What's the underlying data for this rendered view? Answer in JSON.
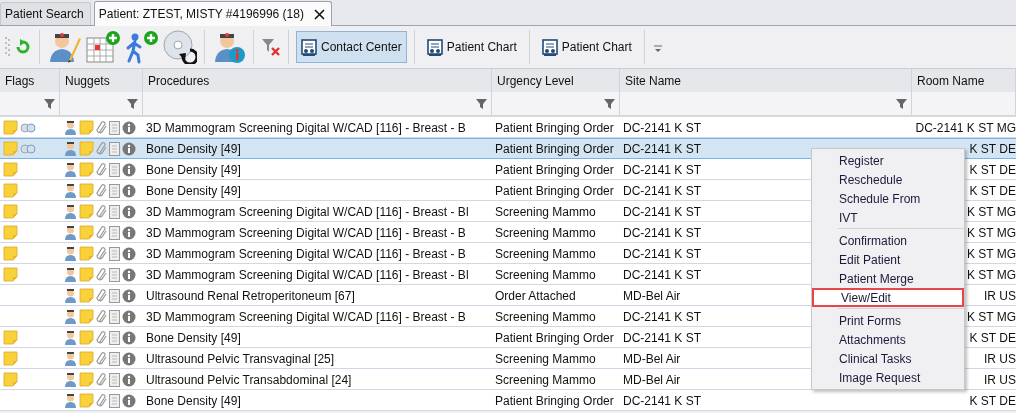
{
  "tabs": [
    {
      "label": "Patient Search",
      "selected": false,
      "closable": false
    },
    {
      "label": "Patient: ZTEST, MISTY #4196996 (18)",
      "selected": true,
      "closable": true
    }
  ],
  "toolbar": [
    {
      "kind": "grip"
    },
    {
      "kind": "refresh"
    },
    {
      "kind": "separator"
    },
    {
      "kind": "person-pencil"
    },
    {
      "kind": "calendar-plus"
    },
    {
      "kind": "walker-plus"
    },
    {
      "kind": "disc"
    },
    {
      "kind": "separator"
    },
    {
      "kind": "person-info"
    },
    {
      "kind": "separator"
    },
    {
      "kind": "filter-clear"
    },
    {
      "kind": "separator"
    },
    {
      "kind": "text",
      "label": "Contact Center",
      "pressed": true
    },
    {
      "kind": "separator"
    },
    {
      "kind": "text",
      "label": "Patient Chart",
      "pressed": false
    },
    {
      "kind": "separator"
    },
    {
      "kind": "text",
      "label": "Patient Chart",
      "pressed": false
    },
    {
      "kind": "separator"
    },
    {
      "kind": "overflow"
    }
  ],
  "table": {
    "columns": [
      {
        "label": "Flags",
        "filter": true
      },
      {
        "label": "Nuggets",
        "filter": true
      },
      {
        "label": "Procedures",
        "filter": true
      },
      {
        "label": "Urgency Level",
        "filter": true
      },
      {
        "label": "Site Name",
        "filter": true
      },
      {
        "label": "Room Name",
        "filter": false
      }
    ],
    "rows": [
      {
        "note": true,
        "linked": true,
        "procedure": "3D Mammogram Screening Digital W/CAD [116] - Breast - B",
        "urgency": "Patient Bringing Order",
        "site": "DC-2141 K ST",
        "room": "DC-2141 K ST MG",
        "selected": false
      },
      {
        "note": true,
        "linked": true,
        "procedure": "Bone Density [49]",
        "urgency": "Patient Bringing Order",
        "site": "DC-2141 K ST",
        "room": "K ST DE",
        "selected": true
      },
      {
        "note": true,
        "linked": false,
        "procedure": "Bone Density [49]",
        "urgency": "Patient Bringing Order",
        "site": "DC-2141 K ST",
        "room": "K ST DE",
        "selected": false
      },
      {
        "note": true,
        "linked": false,
        "procedure": "Bone Density [49]",
        "urgency": "Patient Bringing Order",
        "site": "DC-2141 K ST",
        "room": "K ST DE",
        "selected": false
      },
      {
        "note": true,
        "linked": false,
        "procedure": "3D Mammogram Screening Digital W/CAD [116] - Breast - Bl",
        "urgency": "Screening Mammo",
        "site": "DC-2141 K ST",
        "room": "K ST MG",
        "selected": false
      },
      {
        "note": true,
        "linked": false,
        "procedure": "3D Mammogram Screening Digital W/CAD [116] - Breast - B",
        "urgency": "Screening Mammo",
        "site": "DC-2141 K ST",
        "room": "K ST MG",
        "selected": false
      },
      {
        "note": true,
        "linked": false,
        "procedure": "3D Mammogram Screening Digital W/CAD [116] - Breast - B",
        "urgency": "Screening Mammo",
        "site": "DC-2141 K ST",
        "room": "K ST MG",
        "selected": false
      },
      {
        "note": true,
        "linked": false,
        "procedure": "3D Mammogram Screening Digital W/CAD [116] - Breast - Bl",
        "urgency": "Screening Mammo",
        "site": "DC-2141 K ST",
        "room": "K ST MG",
        "selected": false
      },
      {
        "note": false,
        "linked": false,
        "procedure": "Ultrasound Renal Retroperitoneum [67]",
        "urgency": "Order Attached",
        "site": "MD-Bel Air",
        "room": "IR US",
        "selected": false
      },
      {
        "note": false,
        "linked": false,
        "procedure": "3D Mammogram Screening Digital W/CAD [116] - Breast - B",
        "urgency": "Screening Mammo",
        "site": "DC-2141 K ST",
        "room": "K ST MG",
        "selected": false
      },
      {
        "note": true,
        "linked": false,
        "procedure": "Bone Density [49]",
        "urgency": "Patient Bringing Order",
        "site": "DC-2141 K ST",
        "room": "K ST DE",
        "selected": false
      },
      {
        "note": true,
        "linked": false,
        "procedure": "Ultrasound Pelvic Transvaginal [25]",
        "urgency": "Screening Mammo",
        "site": "MD-Bel Air",
        "room": "IR US",
        "selected": false
      },
      {
        "note": true,
        "linked": false,
        "procedure": "Ultrasound Pelvic Transabdominal [24]",
        "urgency": "Screening Mammo",
        "site": "MD-Bel Air",
        "room": "IR US",
        "selected": false
      },
      {
        "note": false,
        "linked": false,
        "procedure": "Bone Density [49]",
        "urgency": "Patient Bringing Order",
        "site": "DC-2141 K ST",
        "room": "K ST DE",
        "selected": false
      }
    ]
  },
  "context_menu": {
    "items": [
      {
        "kind": "item",
        "label": "Register",
        "highlighted": false
      },
      {
        "kind": "item",
        "label": "Reschedule",
        "highlighted": false
      },
      {
        "kind": "item",
        "label": "Schedule From",
        "highlighted": false
      },
      {
        "kind": "item",
        "label": "IVT",
        "highlighted": false
      },
      {
        "kind": "separator"
      },
      {
        "kind": "item",
        "label": "Confirmation",
        "highlighted": false
      },
      {
        "kind": "item",
        "label": "Edit Patient",
        "highlighted": false
      },
      {
        "kind": "item",
        "label": "Patient Merge",
        "highlighted": false
      },
      {
        "kind": "item",
        "label": "View/Edit",
        "highlighted": true
      },
      {
        "kind": "separator"
      },
      {
        "kind": "item",
        "label": "Print Forms",
        "highlighted": false
      },
      {
        "kind": "item",
        "label": "Attachments",
        "highlighted": false
      },
      {
        "kind": "item",
        "label": "Clinical Tasks",
        "highlighted": false
      },
      {
        "kind": "item",
        "label": "Image Request",
        "highlighted": false
      }
    ]
  }
}
